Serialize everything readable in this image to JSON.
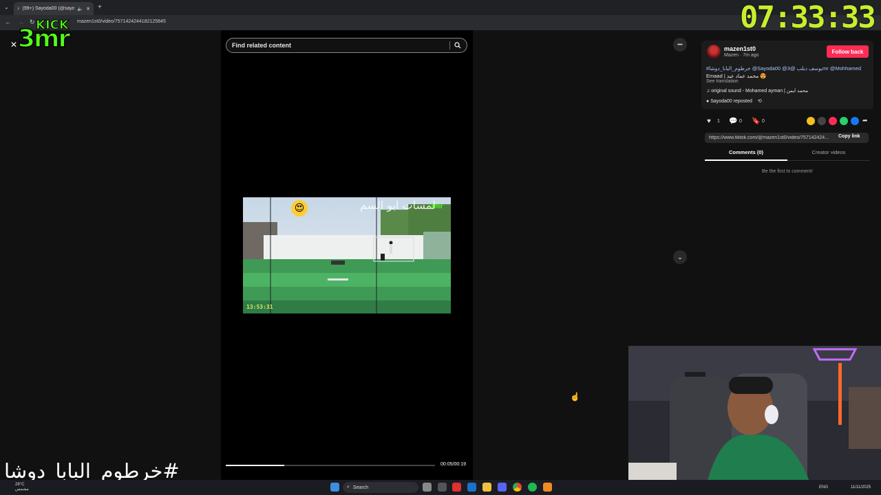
{
  "browser": {
    "tab_title": "(99+) Sayoda00 (@sayoda...",
    "url": "mazen1st0/video/7571424244182125845",
    "new_tab_symbol": "+"
  },
  "overlay": {
    "clock": "07:33:33",
    "kick_logo_text_top": "KICK",
    "kick_logo_text_bottom": "3mr",
    "hashtag": "#خرطوم_البابا_دوشا"
  },
  "video_page": {
    "search_placeholder": "Find related content",
    "time": "00:05/00:19",
    "progress_fraction": 0.28,
    "video_timestamp": "13:53:31",
    "video_watermark": "3mr",
    "video_caption_overlay": "لمسات ابو السم"
  },
  "post": {
    "username": "mazen1st0",
    "subtitle": "Mazen · 7m ago",
    "follow_label": "Follow back",
    "caption_line1_tags": "#خرطوم_البابا_دوشا @Sayoda00 @يوسف ديلب @3mr @Mohhamed",
    "caption_line2": "Emaad | محمد عماد عيد 😍",
    "see_translation": "See translation",
    "sound": "original sound - Mohamed ayman | محمد ايمن",
    "repost": "Sayoda00 reposted",
    "likes": "1",
    "comments": "0",
    "saves": "0",
    "share_link": "https://www.tiktok.com/@mazen1st0/video/757142424...",
    "copy_link_label": "Copy link",
    "tab_comments": "Comments (0)",
    "tab_creator": "Creator videos",
    "empty_comments": "Be the first to comment!",
    "more_symbol": "•••"
  },
  "taskbar": {
    "search_label": "Search",
    "weather_temp": "28°C",
    "weather_desc": "مشمس",
    "lang": "ENG",
    "date": "11/11/2025"
  },
  "colors": {
    "accent_pink": "#fe2c55",
    "clock_green": "#c6ef2c",
    "kick_green": "#53fc18"
  }
}
